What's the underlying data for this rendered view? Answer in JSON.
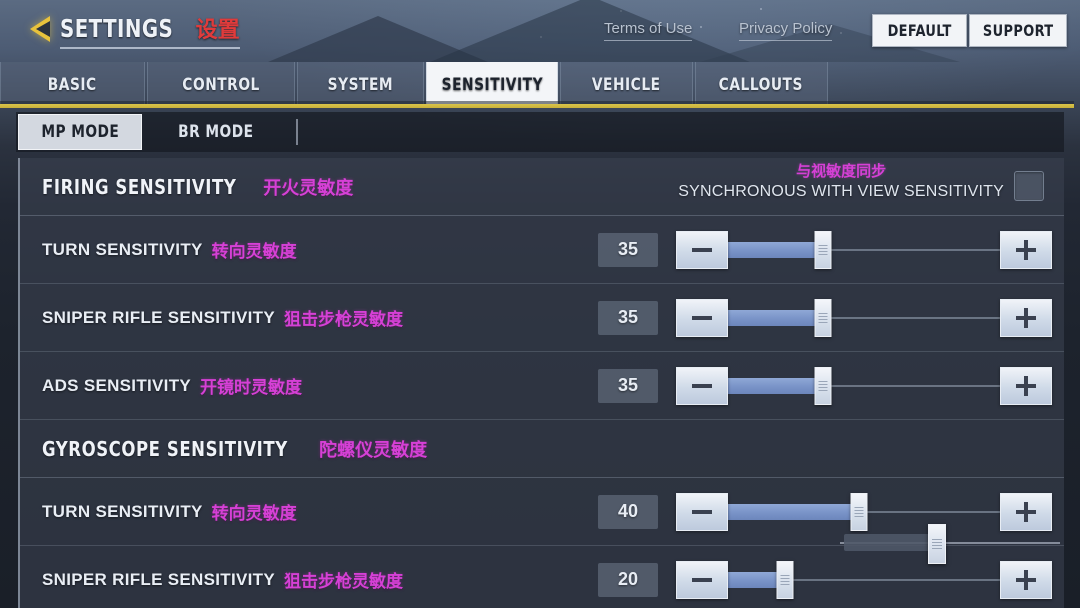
{
  "header": {
    "back_icon": "back-arrow-icon",
    "title_en": "SETTINGS",
    "title_cn": "设置",
    "links": [
      {
        "label": "Terms of Use",
        "name": "link-terms"
      },
      {
        "label": "Privacy Policy",
        "name": "link-privacy"
      }
    ],
    "buttons": [
      {
        "label": "DEFAULT",
        "name": "btn-default"
      },
      {
        "label": "SUPPORT",
        "name": "btn-support"
      }
    ]
  },
  "tabs": [
    {
      "label": "BASIC",
      "active": false
    },
    {
      "label": "CONTROL",
      "active": false
    },
    {
      "label": "SYSTEM",
      "active": false
    },
    {
      "label": "SENSITIVITY",
      "active": true
    },
    {
      "label": "VEHICLE",
      "active": false
    },
    {
      "label": "CALLOUTS",
      "active": false
    }
  ],
  "subtabs": [
    {
      "label": "MP MODE",
      "active": true
    },
    {
      "label": "BR MODE",
      "active": false
    }
  ],
  "sections": [
    {
      "title_en": "FIRING SENSITIVITY",
      "title_cn": "开火灵敏度",
      "sync": {
        "label_cn": "与视敏度同步",
        "label_en": "SYNCHRONOUS WITH VIEW SENSITIVITY",
        "checked": false
      },
      "rows": [
        {
          "label_en": "TURN SENSITIVITY",
          "label_cn": "转向灵敏度",
          "value": "35",
          "percent": 35
        },
        {
          "label_en": "SNIPER RIFLE SENSITIVITY",
          "label_cn": "狙击步枪灵敏度",
          "value": "35",
          "percent": 35
        },
        {
          "label_en": "ADS SENSITIVITY",
          "label_cn": "开镜时灵敏度",
          "value": "35",
          "percent": 35
        }
      ]
    },
    {
      "title_en": "GYROSCOPE SENSITIVITY",
      "title_cn": "陀螺仪灵敏度",
      "rows": [
        {
          "label_en": "TURN SENSITIVITY",
          "label_cn": "转向灵敏度",
          "value": "40",
          "percent": 48
        },
        {
          "label_en": "SNIPER RIFLE SENSITIVITY",
          "label_cn": "狙击步枪灵敏度",
          "value": "20",
          "percent": 21
        }
      ]
    }
  ],
  "slider_controls": {
    "minus_icon": "minus-icon",
    "plus_icon": "plus-icon",
    "thumb_icon": "slider-thumb-handle"
  },
  "colors": {
    "accent_cn_text": "#d640d6",
    "title_cn_text": "#e03b3b",
    "tab_underline": "#d9c44a",
    "slider_fill": "#7b95c9",
    "active_tab_bg": "#f3f5f8"
  }
}
